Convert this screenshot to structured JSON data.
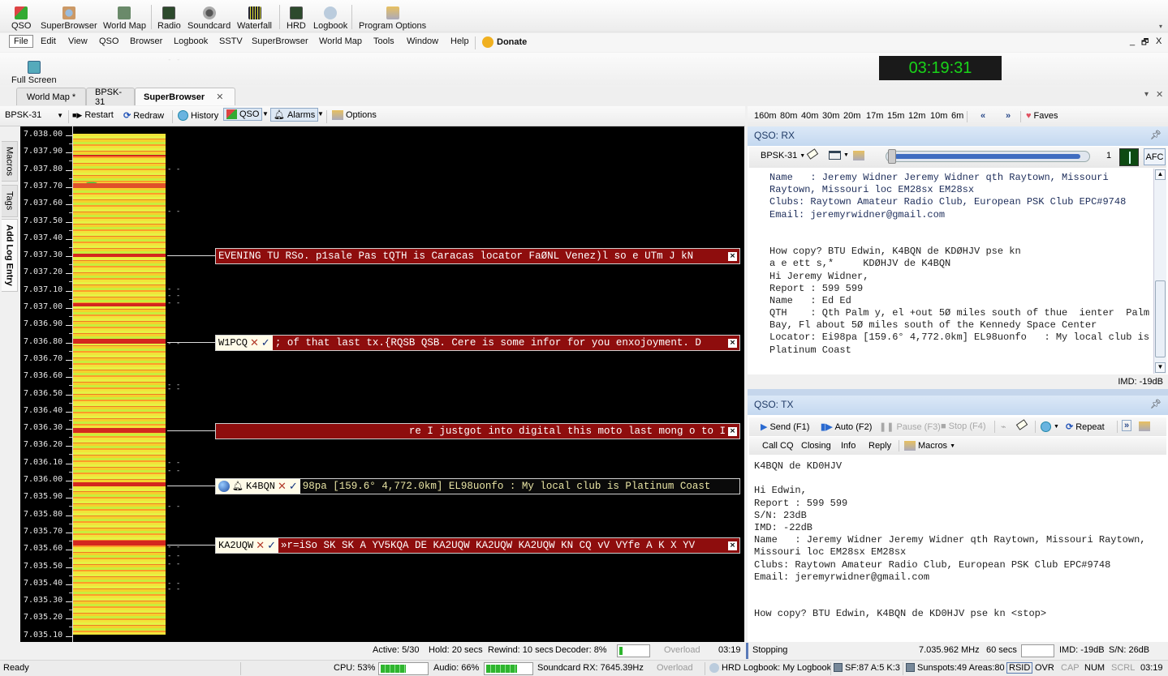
{
  "toolbar": {
    "buttons": [
      {
        "label": "QSO",
        "icon": "qso-people-icon"
      },
      {
        "label": "SuperBrowser",
        "icon": "superbrowser-icon"
      },
      {
        "label": "World Map",
        "icon": "world-map-icon"
      },
      {
        "label": "Radio",
        "icon": "radio-icon"
      },
      {
        "label": "Soundcard",
        "icon": "soundcard-icon"
      },
      {
        "label": "Waterfall",
        "icon": "waterfall-icon"
      },
      {
        "label": "HRD",
        "icon": "hrd-icon"
      },
      {
        "label": "Logbook",
        "icon": "logbook-icon"
      },
      {
        "label": "Program Options",
        "icon": "program-options-icon"
      }
    ]
  },
  "menu": {
    "items": [
      "File",
      "Edit",
      "View",
      "QSO",
      "Browser",
      "Logbook",
      "SSTV",
      "SuperBrowser",
      "World Map",
      "Tools",
      "Window",
      "Help"
    ],
    "donate": "Donate",
    "window_controls": [
      "_",
      "🗗",
      "X"
    ]
  },
  "fullscreen": {
    "label": "Full Screen"
  },
  "clock": "03:19:31",
  "tabs": [
    {
      "label": "World Map *",
      "active": false
    },
    {
      "label": "BPSK-31",
      "active": false
    },
    {
      "label": "SuperBrowser",
      "active": true
    }
  ],
  "sb_toolbar": {
    "mode": "BPSK-31",
    "restart": "Restart",
    "redraw": "Redraw",
    "history": "History",
    "qso": "QSO",
    "alarms": "Alarms",
    "options": "Options"
  },
  "side_tabs": [
    "Macros",
    "Tags",
    "Add Log Entry"
  ],
  "waterfall": {
    "freq_ticks": [
      "7.038.00",
      "7.037.90",
      "7.037.80",
      "7.037.70",
      "7.037.60",
      "7.037.50",
      "7.037.40",
      "7.037.30",
      "7.037.20",
      "7.037.10",
      "7.037.00",
      "7.036.90",
      "7.036.80",
      "7.036.70",
      "7.036.60",
      "7.036.50",
      "7.036.40",
      "7.036.30",
      "7.036.20",
      "7.036.10",
      "7.036.00",
      "7.035.90",
      "7.035.80",
      "7.035.70",
      "7.035.60",
      "7.035.50",
      "7.035.40",
      "7.035.30",
      "7.035.20",
      "7.035.10"
    ],
    "decodes": [
      {
        "callsign": "",
        "text": "EVENING TU RSo. p1sale Pas tQTH is Caracas locator FaØNL Venez)l so e UTm J kN",
        "style": "red",
        "align": "left"
      },
      {
        "callsign": "W1PCQ",
        "text": "; of that last tx.{RQSB QSB. Cere is some infor for you enxojoyment. D",
        "style": "red",
        "align": "left"
      },
      {
        "callsign": "",
        "text": "re I justgot into digital this moto last mong o to I",
        "style": "red",
        "align": "right"
      },
      {
        "callsign": "K4BQN",
        "text": "98pa [159.6° 4,772.0km] EL98uonfo : My local club is Platinum Coast",
        "style": "dark",
        "align": "left",
        "icons": [
          "globe-icon",
          "bell-icon"
        ]
      },
      {
        "callsign": "KA2UQW",
        "text": "»r=iSo SK SK A YV5KQA DE KA2UQW KA2UQW KA2UQW KN CQ vV VYfe A K X YV",
        "style": "red",
        "align": "left"
      }
    ]
  },
  "bands": [
    "160m",
    "80m",
    "40m",
    "30m",
    "20m",
    "17m",
    "15m",
    "12m",
    "10m",
    "6m"
  ],
  "band_nav": {
    "prev": "«",
    "next": "»",
    "faves": "Faves"
  },
  "qso_rx": {
    "title": "QSO: RX",
    "mode": "BPSK-31",
    "slider_value": "1",
    "slider_fraction": 0.97,
    "afc": "AFC",
    "lines": [
      "Name   : Jeremy Widner Jeremy Widner qth Raytown, Missouri",
      "Raytown, Missouri loc EM28sx EM28sx",
      "Clubs: Raytown Amateur Radio Club, European PSK Club EPC#9748",
      "Email: jeremyrwidner@gmail.com",
      "",
      "",
      "How copy? BTU Edwin, K4BQN de KDØHJV pse kn",
      "a e ett s,*     KDØHJV de K4BQN",
      "Hi Jeremy Widner,",
      "Report : 599 599",
      "Name   : Ed Ed",
      "QTH    : Qth Palm y, el +out 5Ø miles south of thue  ienter  Palm",
      "Bay, Fl about 5Ø miles south of the Kennedy Space Center",
      "Locator: Ei98pa [159.6° 4,772.0km] EL98uonfo   : My local club is",
      "Platinum Coast"
    ],
    "imd": "IMD: -19dB"
  },
  "qso_tx": {
    "title": "QSO: TX",
    "send": "Send (F1)",
    "auto": "Auto (F2)",
    "pause": "Pause (F3)",
    "stop": "Stop (F4)",
    "repeat": "Repeat",
    "macros_row": [
      "Call CQ",
      "Closing",
      "Info",
      "Reply"
    ],
    "macros": "Macros",
    "lines": [
      "K4BQN de KD0HJV",
      "",
      "Hi Edwin,",
      "Report : 599 599",
      "S/N: 23dB",
      "IMD: -22dB",
      "Name   : Jeremy Widner Jeremy Widner qth Raytown, Missouri Raytown,",
      "Missouri loc EM28sx EM28sx",
      "Clubs: Raytown Amateur Radio Club, European PSK Club EPC#9748",
      "Email: jeremyrwidner@gmail.com",
      "",
      "",
      "How copy? BTU Edwin, K4BQN de KD0HJV pse kn <stop>"
    ]
  },
  "status": {
    "active": "Active: 5/30",
    "hold": "Hold: 20 secs",
    "rewind": "Rewind: 10 secs",
    "decoder": "Decoder: 8%",
    "decoder_fraction": 0.08,
    "overload1": "Overload",
    "time1": "03:19",
    "state": "Stopping",
    "freq": "7.035.962 MHz",
    "secs": "60 secs",
    "imd": "IMD: -19dB",
    "sn": "S/N: 26dB",
    "ready": "Ready",
    "cpu": "CPU: 53%",
    "cpu_fraction": 0.53,
    "audio": "Audio: 66%",
    "audio_fraction": 0.66,
    "soundcard": "Soundcard RX: 7645.39Hz",
    "overload2": "Overload",
    "logbook": "HRD Logbook: My Logbook",
    "sf": "SF:87 A:5 K:3",
    "sunspots": "Sunspots:49 Areas:80",
    "rsid": "RSID",
    "ovr": "OVR",
    "cap": "CAP",
    "num": "NUM",
    "scrl": "SCRL",
    "time2": "03:19"
  }
}
